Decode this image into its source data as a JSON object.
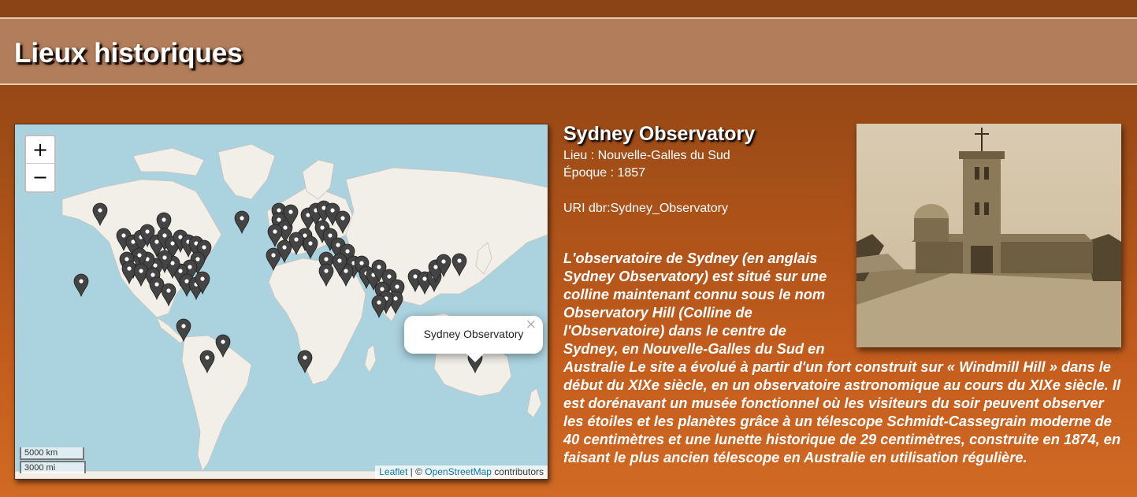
{
  "header": {
    "title": "Lieux historiques"
  },
  "map": {
    "zoom_in_label": "+",
    "zoom_out_label": "−",
    "scale_km": "5000 km",
    "scale_mi": "3000 mi",
    "attribution": {
      "leaflet": "Leaflet",
      "separator": " | © ",
      "osm": "OpenStreetMap",
      "suffix": " contributors"
    },
    "popup": {
      "text": "Sydney Observatory",
      "close": "×"
    }
  },
  "place": {
    "name": "Sydney Observatory",
    "location_line": "Lieu : Nouvelle-Galles du Sud",
    "epoch_line": "Époque : 1857",
    "uri_line": "URI dbr:Sydney_Observatory",
    "description": "L'observatoire de Sydney (en anglais Sydney Observatory) est situé sur une colline maintenant connu sous le nom Observatory Hill (Colline de l'Observatoire) dans le centre de Sydney, en Nouvelle-Galles du Sud en Australie Le site a évolué à partir d'un fort construit sur « Windmill Hill » dans le début du XIXe siècle, en un observatoire astronomique au cours du XIXe siècle. Il est dorénavant un musée fonctionnel où les visiteurs du soir peuvent observer les étoiles et les planètes grâce à un télescope Schmidt-Cassegrain moderne de 40 centimètres et une lunette historique de 29 centimètres, construite en 1874, en faisant le plus ancien télescope en Australie en utilisation régulière."
  },
  "colors": {
    "background": "#c05a1c",
    "header": "#b27d5a",
    "ocean": "#aad3df",
    "land": "#f2efe9",
    "marker": "#444444"
  }
}
